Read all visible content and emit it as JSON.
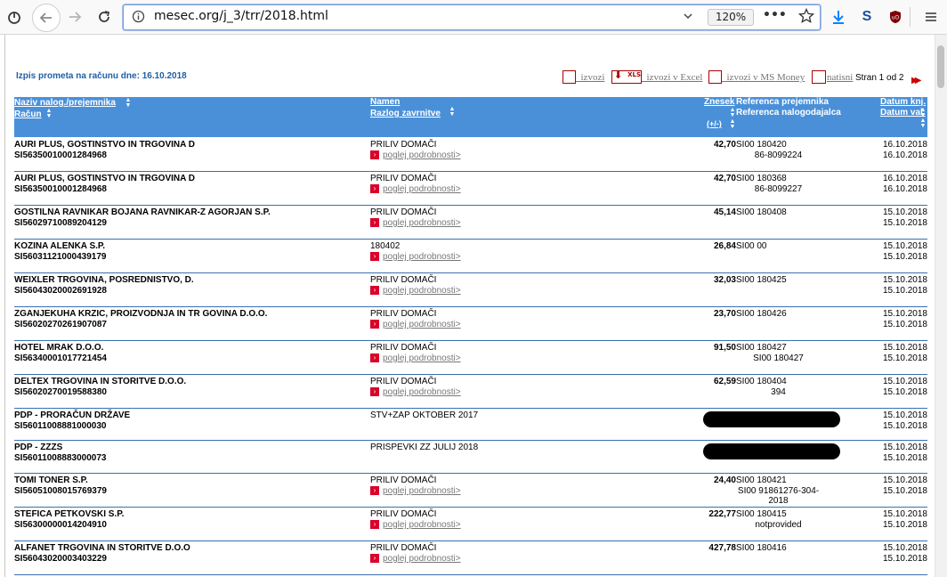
{
  "browser": {
    "url": "mesec.org/j_3/trr/2018.html",
    "zoom": "120%"
  },
  "page": {
    "heading": "Izpis prometa na računu dne: 16.10.2018",
    "exports": {
      "izvozi": "_izvozi",
      "xls_badge": "XLS",
      "excel": "_izvozi v Excel",
      "ms_money": "_izvozi v MS Money",
      "natisni": "natisni"
    },
    "pager": "Stran 1 od 2"
  },
  "table": {
    "headers": {
      "name": "Naziv nalog./prejemnika",
      "account": "Račun",
      "purpose": "Namen",
      "reason": "Razlog zavrnitve",
      "amount": "Znesek",
      "sign": "(+/-)",
      "ref_recipient": "Referenca prejemnika",
      "ref_payer": "Referenca nalogodajalca",
      "date_booking": "Datum knj.",
      "date_value": "Datum val."
    },
    "detail_link": "poglej podrobnosti>",
    "rows": [
      {
        "name": "AURI PLUS, GOSTINSTVO IN TRGOVINA D",
        "account": "SI56350010001284968",
        "purpose": "PRILIV DOMAČI",
        "amount": "42,70",
        "ref1": "SI00 180420",
        "ref2": "86-8099224",
        "d1": "16.10.2018",
        "d2": "16.10.2018",
        "details": true
      },
      {
        "name": "AURI PLUS, GOSTINSTVO IN TRGOVINA D",
        "account": "SI56350010001284968",
        "purpose": "PRILIV DOMAČI",
        "amount": "42,70",
        "ref1": "SI00 180368",
        "ref2": "86-8099227",
        "d1": "16.10.2018",
        "d2": "16.10.2018",
        "details": true
      },
      {
        "name": "GOSTILNA RAVNIKAR BOJANA RAVNIKAR-Z AGORJAN S.P.",
        "account": "SI56029710089204129",
        "purpose": "PRILIV DOMAČI",
        "amount": "45,14",
        "ref1": "SI00 180408",
        "ref2": "",
        "d1": "15.10.2018",
        "d2": "15.10.2018",
        "details": true
      },
      {
        "name": "KOZINA ALENKA S.P.",
        "account": "SI56031121000439179",
        "purpose": "180402",
        "amount": "26,84",
        "ref1": "SI00 00",
        "ref2": "",
        "d1": "15.10.2018",
        "d2": "15.10.2018",
        "details": true
      },
      {
        "name": "WEIXLER TRGOVINA, POSREDNISTVO, D.",
        "account": "SI56043020002691928",
        "purpose": "PRILIV DOMAČI",
        "amount": "32,03",
        "ref1": "SI00 180425",
        "ref2": "",
        "d1": "15.10.2018",
        "d2": "15.10.2018",
        "details": true
      },
      {
        "name": "ZGANJEKUHA KRZIC, PROIZVODNJA IN TR GOVINA D.O.O.",
        "account": "SI56020270261907087",
        "purpose": "PRILIV DOMAČI",
        "amount": "23,70",
        "ref1": "SI00 180426",
        "ref2": "",
        "d1": "15.10.2018",
        "d2": "15.10.2018",
        "details": true
      },
      {
        "name": "HOTEL MRAK D.O.O.",
        "account": "SI56340001017721454",
        "purpose": "PRILIV DOMAČI",
        "amount": "91,50",
        "ref1": "SI00 180427",
        "ref2": "SI00 180427",
        "d1": "15.10.2018",
        "d2": "15.10.2018",
        "details": true
      },
      {
        "name": "DELTEX TRGOVINA IN STORITVE D.O.O.",
        "account": "SI56020270019588380",
        "purpose": "PRILIV DOMAČI",
        "amount": "62,59",
        "ref1": "SI00 180404",
        "ref2": "394",
        "d1": "15.10.2018",
        "d2": "15.10.2018",
        "details": true
      },
      {
        "name": "PDP - PRORAČUN DRŽAVE",
        "account": "SI56011008881000030",
        "purpose": "STV+ZAP OKTOBER 2017",
        "amount": "",
        "ref1": "",
        "ref2": "",
        "d1": "15.10.2018",
        "d2": "15.10.2018",
        "details": false,
        "redacted": true
      },
      {
        "name": "PDP - ZZZS",
        "account": "SI56011008883000073",
        "purpose": "PRISPEVKI ZZ JULIJ 2018",
        "amount": "",
        "ref1": "",
        "ref2": "",
        "d1": "15.10.2018",
        "d2": "15.10.2018",
        "details": false,
        "redacted": true
      },
      {
        "name": "TOMI TONER S.P.",
        "account": "SI56051008015769379",
        "purpose": "PRILIV DOMAČI",
        "amount": "24,40",
        "ref1": "SI00 180421",
        "ref2": "SI00 91861276-304-2018",
        "d1": "15.10.2018",
        "d2": "15.10.2018",
        "details": true
      },
      {
        "name": "STEFICA PETKOVSKI S.P.",
        "account": "SI56300000014204910",
        "purpose": "PRILIV DOMAČI",
        "amount": "222,77",
        "ref1": "SI00 180415",
        "ref2": "notprovided",
        "d1": "15.10.2018",
        "d2": "15.10.2018",
        "details": true
      },
      {
        "name": "ALFANET TRGOVINA IN STORITVE D.O.O",
        "account": "SI56043020003403229",
        "purpose": "PRILIV DOMAČI",
        "amount": "427,78",
        "ref1": "SI00 180416",
        "ref2": "",
        "d1": "15.10.2018",
        "d2": "15.10.2018",
        "details": true
      }
    ]
  }
}
